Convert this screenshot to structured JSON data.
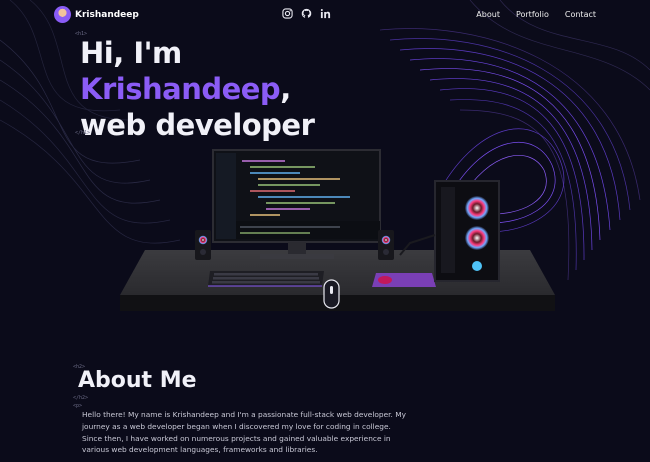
{
  "nav": {
    "brand": "Krishandeep",
    "social_icons": [
      "instagram-icon",
      "github-icon",
      "linkedin-icon"
    ],
    "links": [
      "About",
      "Portfolio",
      "Contact"
    ]
  },
  "hero": {
    "open_tag": "<h1>",
    "line1": "Hi, I'm",
    "name": "Krishandeep",
    "name_suffix": ",",
    "line3": "web developer",
    "close_tag": "</h1>"
  },
  "about": {
    "open_tag": "<h2>",
    "title": "About Me",
    "close_tag": "</h2>",
    "p_tag": "<p>",
    "paragraph": "Hello there! My name is Krishandeep and I'm a passionate full-stack web developer. My journey as a web developer began when I discovered my love for coding in college. Since then, I have worked on numerous projects and gained valuable experience in various web development languages, frameworks and libraries."
  },
  "colors": {
    "background": "#0b0b1a",
    "accent": "#8b5cf6",
    "text": "#f1f1f8"
  }
}
